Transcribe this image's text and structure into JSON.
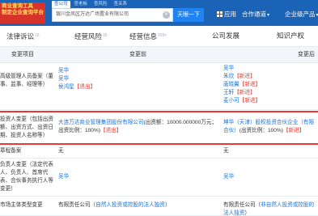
{
  "header": {
    "logo_lines": [
      "商业查询工具",
      "制定企业查询平台"
    ],
    "search_tabs": [
      "查公司",
      "查老板",
      "查风险",
      "查关系"
    ],
    "search_value": "银川金凤区万达广场置业有限公司",
    "clear_icon": "✕",
    "search_button": "天眼一下",
    "nav": {
      "apps": "应用",
      "cooperation": "合作通道",
      "enterprise": "企业级产品"
    }
  },
  "subnav": {
    "tabs": [
      {
        "label": "法律诉讼",
        "count": "18"
      },
      {
        "label": "经营风险",
        "count": "16"
      },
      {
        "label": "经营信息",
        "count": "999+"
      },
      {
        "label": "公司发展",
        "count": ""
      },
      {
        "label": "知识产权",
        "count": ""
      }
    ]
  },
  "table": {
    "headers": [
      "变更项目",
      "变更前",
      "变更后"
    ],
    "rows": [
      {
        "item": [
          "高级管理人员备案（董",
          "事、监事、经理等）"
        ],
        "before": [
          {
            "name": "吴华",
            "tag": ""
          },
          {
            "name": "吴华",
            "tag": ""
          },
          {
            "name": "侯鸿星",
            "tag": "【退出】"
          }
        ],
        "after": [
          {
            "name": "吴华",
            "tag": ""
          },
          {
            "name": "朱欣",
            "tag": "【新进】"
          },
          {
            "name": "唐晓翼",
            "tag": "【新进】"
          },
          {
            "name": "王轩",
            "tag": "【新进】"
          },
          {
            "name": "麦小可",
            "tag": "【新进】"
          }
        ]
      },
      {
        "item": [
          "投资人变更（包括出资",
          "额、出资方式、出资日",
          "期、投资人名称等）"
        ],
        "before_link": "大连万达商业管理集团股份有限公司",
        "before_text": "(出资额：10000.000000万元；出资比例：100%)",
        "before_tag": "【退出】",
        "after_link": "坤华（天津）股权投资合伙企业（有限合伙）",
        "after_text": "(出资比例：100%)",
        "after_tag": "【新进】"
      },
      {
        "item": [
          "章程备案"
        ],
        "before": "无",
        "after": "无"
      },
      {
        "item": [
          "负责人变更（法定代表",
          "人、负责人、首席代",
          "表、合伙事务执行人等",
          "变更）"
        ],
        "before": "吴华",
        "after": "吴华"
      },
      {
        "item": [
          "市场主体类型变更"
        ],
        "before_prefix": "有限责任公司（",
        "before_link": "自然人投资或控股的法人独资",
        "before_suffix": "）",
        "after_prefix": "有限责任公司（",
        "after_link": "非自然人投资或控股的法人独资",
        "after_suffix": "）"
      }
    ]
  },
  "colors": {
    "header_bg": "#1a63b6",
    "accent": "#1f84f2",
    "highlight": "#e33a31",
    "link": "#1a73d9"
  }
}
